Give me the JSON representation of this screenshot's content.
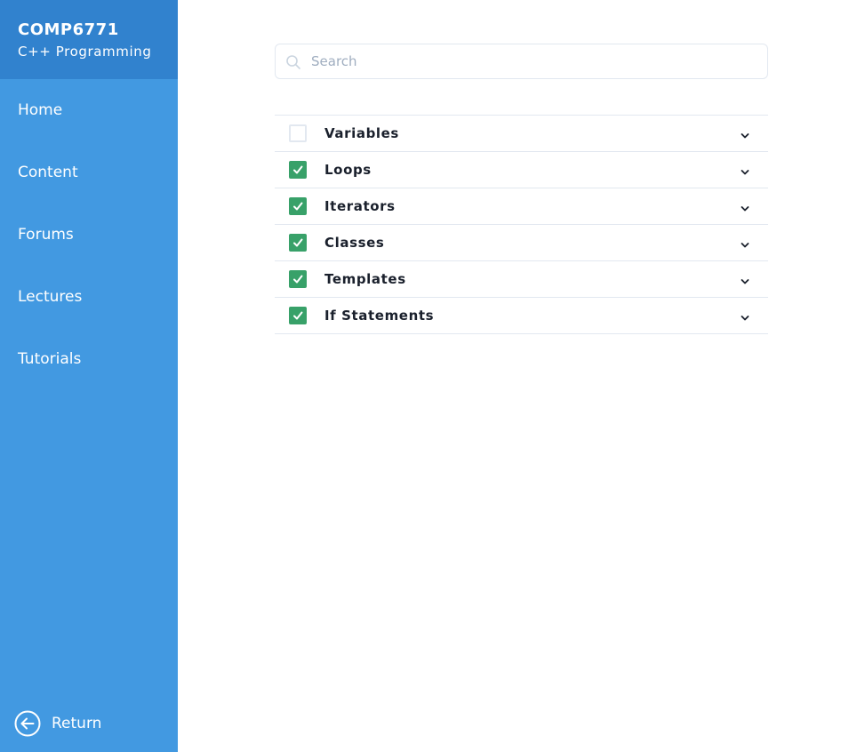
{
  "sidebar": {
    "course_code": "COMP6771",
    "course_name": "C++ Programming",
    "nav_items": [
      {
        "label": "Home"
      },
      {
        "label": "Content"
      },
      {
        "label": "Forums"
      },
      {
        "label": "Lectures"
      },
      {
        "label": "Tutorials"
      }
    ],
    "return_label": "Return",
    "return_icon": "arrow-left-circle-icon"
  },
  "search": {
    "placeholder": "Search",
    "value": "",
    "icon": "search-icon"
  },
  "topics": [
    {
      "label": "Variables",
      "checked": false
    },
    {
      "label": "Loops",
      "checked": true
    },
    {
      "label": "Iterators",
      "checked": true
    },
    {
      "label": "Classes",
      "checked": true
    },
    {
      "label": "Templates",
      "checked": true
    },
    {
      "label": "If Statements",
      "checked": true
    }
  ],
  "colors": {
    "sidebar_bg": "#4299e1",
    "sidebar_header_bg": "#3182ce",
    "checkbox_checked": "#38a169",
    "border": "#e2e8f0"
  }
}
